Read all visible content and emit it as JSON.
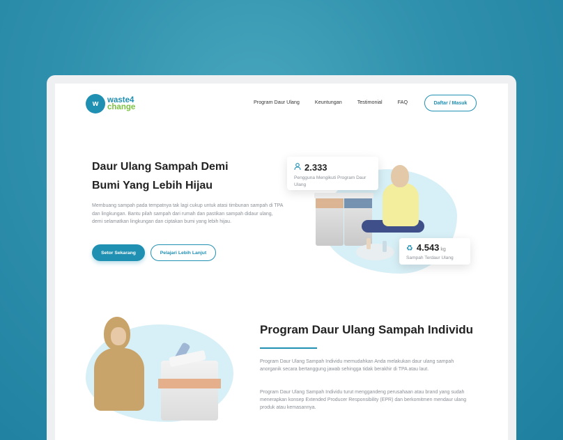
{
  "brand": {
    "logo_mark": "w",
    "logo_line1": "waste4",
    "logo_line2": "change"
  },
  "nav": {
    "items": [
      {
        "label": "Program Daur Ulang"
      },
      {
        "label": "Keuntungan"
      },
      {
        "label": "Testimonial"
      },
      {
        "label": "FAQ"
      }
    ],
    "login_label": "Daftar / Masuk"
  },
  "hero": {
    "title_line1": "Daur Ulang Sampah Demi",
    "title_line2": "Bumi Yang Lebih Hijau",
    "description": "Membuang sampah pada tempatnya tak lagi cukup untuk atasi timbunan sampah di TPA dan lingkungan. Bantu pilah sampah dari rumah dan pastikan sampah didaur ulang, demi selamatkan lingkungan dan ciptakan bumi yang lebih hijau.",
    "primary_button": "Setor Sekarang",
    "secondary_button": "Pelajari Lebih Lanjut"
  },
  "stats": {
    "users": {
      "value": "2.333",
      "label": "Pengguna Mengikuti Program Daur Ulang",
      "icon": "user-icon"
    },
    "recycled": {
      "value": "4.543",
      "unit": "kg",
      "label": "Sampah Terdaur Ulang",
      "icon": "recycle-icon"
    }
  },
  "section2": {
    "title": "Program Daur Ulang Sampah Individu",
    "paragraph1": "Program Daur Ulang Sampah Individu memudahkan Anda melakukan daur ulang sampah anorganik secara bertanggung jawab sehingga tidak berakhir di TPA atau laut.",
    "paragraph2": "Program Daur Ulang Sampah Individu turut menggandeng perusahaan atau brand yang sudah menerapkan konsep Extended Producer Responsibility (EPR) dan berkomitmen mendaur ulang produk atau kemasannya."
  },
  "colors": {
    "accent": "#1f8fb2",
    "brand_green": "#7cc242",
    "background": "#2f90ad"
  }
}
